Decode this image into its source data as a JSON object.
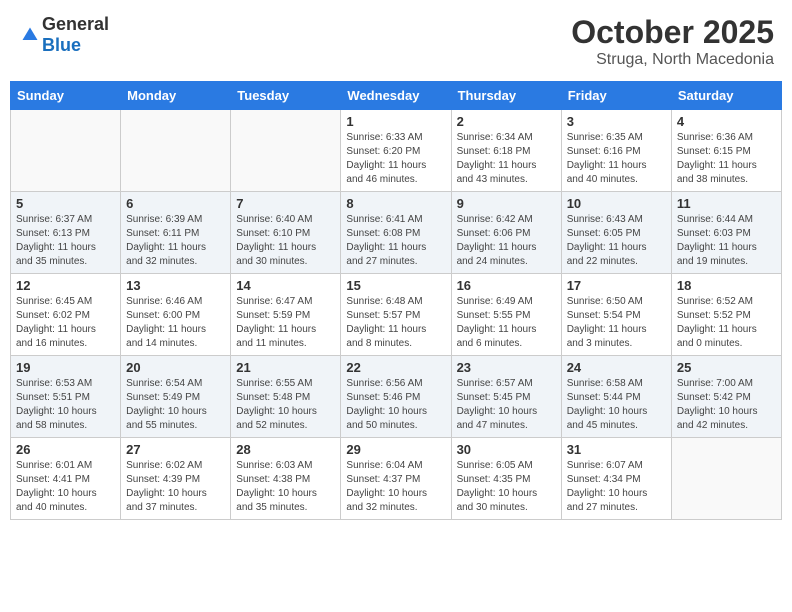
{
  "header": {
    "logo_general": "General",
    "logo_blue": "Blue",
    "month": "October 2025",
    "location": "Struga, North Macedonia"
  },
  "days_of_week": [
    "Sunday",
    "Monday",
    "Tuesday",
    "Wednesday",
    "Thursday",
    "Friday",
    "Saturday"
  ],
  "weeks": [
    {
      "shaded": false,
      "days": [
        {
          "num": "",
          "info": ""
        },
        {
          "num": "",
          "info": ""
        },
        {
          "num": "",
          "info": ""
        },
        {
          "num": "1",
          "info": "Sunrise: 6:33 AM\nSunset: 6:20 PM\nDaylight: 11 hours\nand 46 minutes."
        },
        {
          "num": "2",
          "info": "Sunrise: 6:34 AM\nSunset: 6:18 PM\nDaylight: 11 hours\nand 43 minutes."
        },
        {
          "num": "3",
          "info": "Sunrise: 6:35 AM\nSunset: 6:16 PM\nDaylight: 11 hours\nand 40 minutes."
        },
        {
          "num": "4",
          "info": "Sunrise: 6:36 AM\nSunset: 6:15 PM\nDaylight: 11 hours\nand 38 minutes."
        }
      ]
    },
    {
      "shaded": true,
      "days": [
        {
          "num": "5",
          "info": "Sunrise: 6:37 AM\nSunset: 6:13 PM\nDaylight: 11 hours\nand 35 minutes."
        },
        {
          "num": "6",
          "info": "Sunrise: 6:39 AM\nSunset: 6:11 PM\nDaylight: 11 hours\nand 32 minutes."
        },
        {
          "num": "7",
          "info": "Sunrise: 6:40 AM\nSunset: 6:10 PM\nDaylight: 11 hours\nand 30 minutes."
        },
        {
          "num": "8",
          "info": "Sunrise: 6:41 AM\nSunset: 6:08 PM\nDaylight: 11 hours\nand 27 minutes."
        },
        {
          "num": "9",
          "info": "Sunrise: 6:42 AM\nSunset: 6:06 PM\nDaylight: 11 hours\nand 24 minutes."
        },
        {
          "num": "10",
          "info": "Sunrise: 6:43 AM\nSunset: 6:05 PM\nDaylight: 11 hours\nand 22 minutes."
        },
        {
          "num": "11",
          "info": "Sunrise: 6:44 AM\nSunset: 6:03 PM\nDaylight: 11 hours\nand 19 minutes."
        }
      ]
    },
    {
      "shaded": false,
      "days": [
        {
          "num": "12",
          "info": "Sunrise: 6:45 AM\nSunset: 6:02 PM\nDaylight: 11 hours\nand 16 minutes."
        },
        {
          "num": "13",
          "info": "Sunrise: 6:46 AM\nSunset: 6:00 PM\nDaylight: 11 hours\nand 14 minutes."
        },
        {
          "num": "14",
          "info": "Sunrise: 6:47 AM\nSunset: 5:59 PM\nDaylight: 11 hours\nand 11 minutes."
        },
        {
          "num": "15",
          "info": "Sunrise: 6:48 AM\nSunset: 5:57 PM\nDaylight: 11 hours\nand 8 minutes."
        },
        {
          "num": "16",
          "info": "Sunrise: 6:49 AM\nSunset: 5:55 PM\nDaylight: 11 hours\nand 6 minutes."
        },
        {
          "num": "17",
          "info": "Sunrise: 6:50 AM\nSunset: 5:54 PM\nDaylight: 11 hours\nand 3 minutes."
        },
        {
          "num": "18",
          "info": "Sunrise: 6:52 AM\nSunset: 5:52 PM\nDaylight: 11 hours\nand 0 minutes."
        }
      ]
    },
    {
      "shaded": true,
      "days": [
        {
          "num": "19",
          "info": "Sunrise: 6:53 AM\nSunset: 5:51 PM\nDaylight: 10 hours\nand 58 minutes."
        },
        {
          "num": "20",
          "info": "Sunrise: 6:54 AM\nSunset: 5:49 PM\nDaylight: 10 hours\nand 55 minutes."
        },
        {
          "num": "21",
          "info": "Sunrise: 6:55 AM\nSunset: 5:48 PM\nDaylight: 10 hours\nand 52 minutes."
        },
        {
          "num": "22",
          "info": "Sunrise: 6:56 AM\nSunset: 5:46 PM\nDaylight: 10 hours\nand 50 minutes."
        },
        {
          "num": "23",
          "info": "Sunrise: 6:57 AM\nSunset: 5:45 PM\nDaylight: 10 hours\nand 47 minutes."
        },
        {
          "num": "24",
          "info": "Sunrise: 6:58 AM\nSunset: 5:44 PM\nDaylight: 10 hours\nand 45 minutes."
        },
        {
          "num": "25",
          "info": "Sunrise: 7:00 AM\nSunset: 5:42 PM\nDaylight: 10 hours\nand 42 minutes."
        }
      ]
    },
    {
      "shaded": false,
      "days": [
        {
          "num": "26",
          "info": "Sunrise: 6:01 AM\nSunset: 4:41 PM\nDaylight: 10 hours\nand 40 minutes."
        },
        {
          "num": "27",
          "info": "Sunrise: 6:02 AM\nSunset: 4:39 PM\nDaylight: 10 hours\nand 37 minutes."
        },
        {
          "num": "28",
          "info": "Sunrise: 6:03 AM\nSunset: 4:38 PM\nDaylight: 10 hours\nand 35 minutes."
        },
        {
          "num": "29",
          "info": "Sunrise: 6:04 AM\nSunset: 4:37 PM\nDaylight: 10 hours\nand 32 minutes."
        },
        {
          "num": "30",
          "info": "Sunrise: 6:05 AM\nSunset: 4:35 PM\nDaylight: 10 hours\nand 30 minutes."
        },
        {
          "num": "31",
          "info": "Sunrise: 6:07 AM\nSunset: 4:34 PM\nDaylight: 10 hours\nand 27 minutes."
        },
        {
          "num": "",
          "info": ""
        }
      ]
    }
  ]
}
